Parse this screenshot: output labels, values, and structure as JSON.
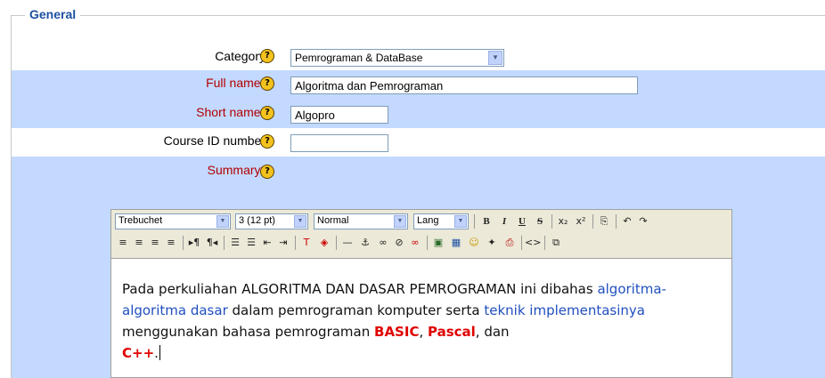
{
  "section": {
    "legend": "General"
  },
  "fields": {
    "category": {
      "label": "Category",
      "value": "Pemrograman & DataBase"
    },
    "fullname": {
      "label": "Full name",
      "required_mark": "*",
      "value": "Algoritma dan Pemrograman"
    },
    "shortname": {
      "label": "Short name",
      "required_mark": "*",
      "value": "Algopro"
    },
    "idnumber": {
      "label": "Course ID number",
      "value": ""
    },
    "summary": {
      "label": "Summary",
      "required_mark": "*"
    }
  },
  "help_icon_glyph": "?",
  "editor": {
    "font": "Trebuchet",
    "size": "3 (12 pt)",
    "format": "Normal",
    "lang": "Lang",
    "buttons_row1": [
      "B",
      "I",
      "U",
      "S",
      "x₂",
      "x²",
      "⎘",
      "↶",
      "↷"
    ],
    "content": {
      "p1": "Pada perkuliahan ALGORITMA DAN DASAR PEMROGRAMAN ini dibahas ",
      "link1": "algoritma-algoritma dasar",
      "p2": " dalam pemrograman komputer serta ",
      "link2": "teknik implementasinya",
      "p3": " menggunakan bahasa pemrograman ",
      "basic": "BASIC",
      "comma": ", ",
      "pascal": "Pascal",
      "p4": ", dan",
      "cpp": "C++",
      "end": "."
    }
  },
  "colors": {
    "row_highlight": "#c3d9ff",
    "legend": "#1e50a2",
    "required": "#b20000"
  }
}
